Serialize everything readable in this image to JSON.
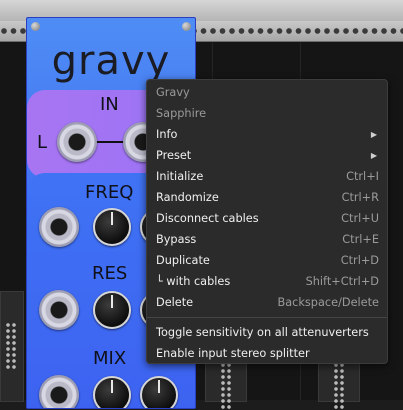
{
  "module": {
    "title": "gravy",
    "sections": {
      "in": "IN",
      "in_channel": "L",
      "freq": "FREQ",
      "res": "RES",
      "mix": "MIX"
    }
  },
  "context_menu": {
    "header_name": "Gravy",
    "header_brand": "Sapphire",
    "items": [
      {
        "label": "Info",
        "submenu": true
      },
      {
        "label": "Preset",
        "submenu": true
      },
      {
        "label": "Initialize",
        "shortcut": "Ctrl+I"
      },
      {
        "label": "Randomize",
        "shortcut": "Ctrl+R"
      },
      {
        "label": "Disconnect cables",
        "shortcut": "Ctrl+U"
      },
      {
        "label": "Bypass",
        "shortcut": "Ctrl+E"
      },
      {
        "label": "Duplicate",
        "shortcut": "Ctrl+D"
      },
      {
        "label": "└ with cables",
        "shortcut": "Shift+Ctrl+D"
      },
      {
        "label": "Delete",
        "shortcut": "Backspace/Delete"
      }
    ],
    "extra_items": [
      {
        "label": "Toggle sensitivity on all attenuverters"
      },
      {
        "label": "Enable input stereo splitter"
      }
    ]
  },
  "colors": {
    "panel_blue": "#4f8df5",
    "band_purple": "#a875f2",
    "menu_bg": "#2b2b2b",
    "menu_text": "#f0f0f0",
    "menu_dim": "#9b9b9b"
  }
}
